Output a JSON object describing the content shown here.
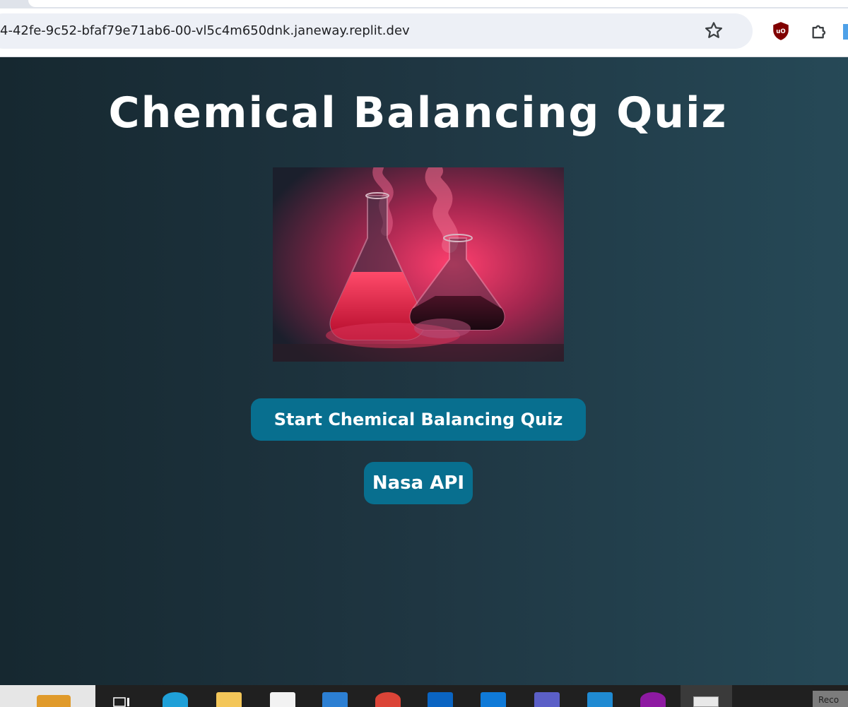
{
  "browser": {
    "url": "4-42fe-9c52-bfaf79e71ab6-00-vl5c4m650dnk.janeway.replit.dev",
    "icons": [
      "star-icon",
      "ublock-origin-icon",
      "extensions-puzzle-icon"
    ]
  },
  "page": {
    "title": "Chemical Balancing Quiz",
    "hero_image": "chemistry-flasks-smoke-image",
    "start_button": "Start Chemical Balancing Quiz",
    "nasa_button": "Nasa API"
  },
  "colors": {
    "button_bg": "#086f8f",
    "page_bg_left": "#162830",
    "page_bg_right": "#264957",
    "title_text": "#ffffff"
  },
  "taskbar": {
    "icons": [
      "file-explorer-bag-icon",
      "task-view-icon",
      "edge-icon",
      "folder-icon",
      "store-icon",
      "mail-icon",
      "chrome-icon",
      "outlook-icon",
      "outlook-new-icon",
      "teams-icon",
      "vscode-icon",
      "app-icon",
      "terminal-icon"
    ],
    "record_label": "Reco"
  }
}
